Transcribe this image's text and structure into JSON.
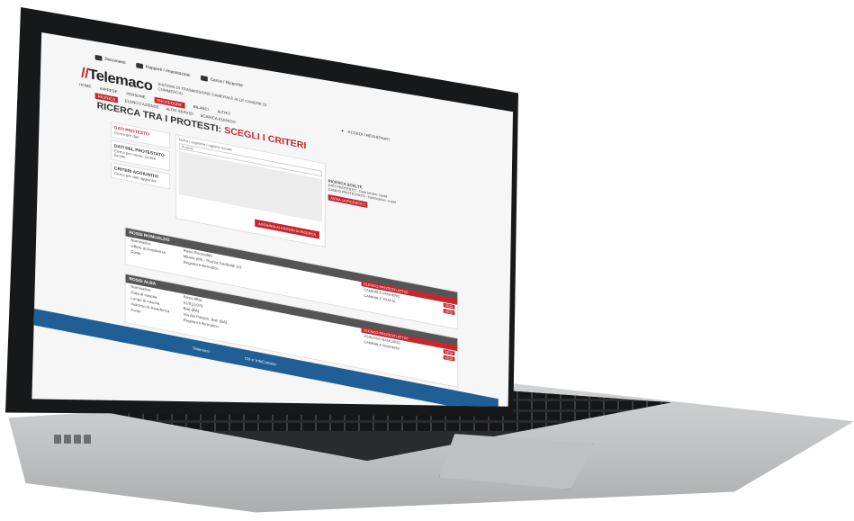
{
  "topbar": [
    {
      "icon": "folder-icon",
      "label": "Documenti"
    },
    {
      "icon": "users-icon",
      "label": "Rapporti / Impostazioni"
    },
    {
      "icon": "search-icon",
      "label": "Cerca / Ricerche"
    }
  ],
  "logo": {
    "text": "Telemaco",
    "subtitle": "SISTEMA DI TRASMISSIONE CAMERALE ALLE CAMERE DI COMMERCIO"
  },
  "user": {
    "label": "ACCEDI / REGISTRATI"
  },
  "nav": [
    "HOME",
    "IMPRESE",
    "PERSONE",
    "PROCEDURE",
    "BILANCI",
    "ALTRO"
  ],
  "nav_active": 3,
  "subnav": [
    "RICERCA",
    "ELENCO AZIENDE",
    "ALTRI SERVIZI",
    "SCARICA ELENCHI"
  ],
  "subnav_active": 0,
  "page_title": {
    "main": "RICERCA TRA I PROTESTI:",
    "accent": "SCEGLI I CRITERI"
  },
  "sidebar": [
    {
      "title": "DATI PROTESTO",
      "sub": "Cerca per dati",
      "active": true
    },
    {
      "title": "DATI DEL PROTESTATO",
      "sub": "Cerca per nome, codice fiscale",
      "active": false
    },
    {
      "title": "CRITERI AGGIUNTIVI",
      "sub": "Cerca per dati aggiuntivi",
      "active": false
    }
  ],
  "search": {
    "label": "Nome / cognome / ragione sociale",
    "field": "Protesti",
    "button": "AGGIUNGI AI CRITERI DI RICERCA"
  },
  "results": {
    "title": "RICERCA SCELTE",
    "items": [
      "DATI PROTESTO - Data levata: vuota",
      "CAMPO PROTESTATO - Nominativo: vuoto"
    ],
    "button": "AVVIA LA RICERCA",
    "count": "2"
  },
  "section1": {
    "title": "ROSSI ROMUALDO",
    "rows": [
      {
        "k": "Nominativo",
        "v": "Rossi Romualdo"
      },
      {
        "k": "Ufficio di Residenza",
        "v": "Milano (MI) - Piazza Garibaldi 1/3"
      },
      {
        "k": "Fonte",
        "v": "Registro Informatico"
      }
    ],
    "side_title": "ELENCO PROTESTI ATTIVI",
    "side_items": [
      {
        "label": "CAMBIALE PAGHERO",
        "badge": "VEDI"
      },
      {
        "label": "CAMBIALE TRATTA",
        "badge": "VEDI"
      }
    ]
  },
  "section2": {
    "title": "ROSSI ALBA",
    "rows": [
      {
        "k": "Nominativo",
        "v": "Rossi Alba"
      },
      {
        "k": "Data di nascita",
        "v": "01/01/1970"
      },
      {
        "k": "Luogo di nascita",
        "v": "Bari (BA)"
      },
      {
        "k": "Indirizzo di Residenza",
        "v": "Via dei Palazzi, Bari (BA)"
      },
      {
        "k": "Fonte",
        "v": "Registro Informatico"
      }
    ],
    "side_title": "ELENCO PROTESTI ATTIVI",
    "side_items": [
      {
        "label": "ASSEGNO BANCARIO",
        "badge": "VEDI"
      },
      {
        "label": "CAMBIALE PAGHERO",
        "badge": "VEDI"
      }
    ]
  },
  "footer": {
    "brand": "Telemaco",
    "link": "Chi e' InfoCamere"
  }
}
